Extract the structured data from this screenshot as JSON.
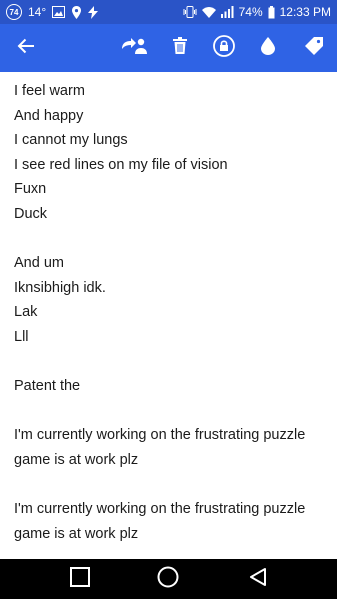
{
  "status_bar": {
    "notification_count": "74",
    "temperature": "14°",
    "battery_percent": "74%",
    "time": "12:33 PM"
  },
  "app_bar": {
    "icons": [
      "back-arrow-icon",
      "share-person-icon",
      "trash-icon",
      "lock-icon",
      "drop-icon",
      "tag-icon"
    ]
  },
  "note": {
    "lines": [
      "I feel warm",
      "And happy",
      "I cannot my lungs",
      "I see red lines on my file of vision",
      "Fuxn",
      "Duck",
      "",
      "And um",
      "Iknsibhigh idk.",
      "Lak",
      "Lll",
      "",
      "Patent the",
      "",
      "I'm currently working on the frustrating puzzle",
      "game is at work plz",
      "",
      "I'm currently working on the frustrating puzzle",
      "game is at work plz"
    ]
  },
  "nav_bar": {
    "icons": [
      "recent-apps-icon",
      "home-icon",
      "back-icon"
    ]
  },
  "colors": {
    "status_bar": "#2a54c7",
    "app_bar": "#2f63e5",
    "text": "#1b1b1b",
    "nav_bar": "#000000"
  }
}
